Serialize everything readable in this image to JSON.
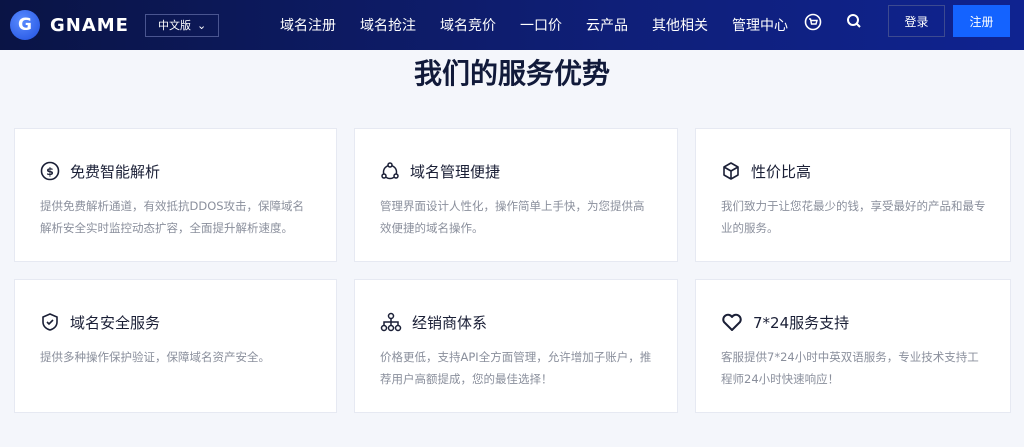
{
  "header": {
    "logo_letter": "G",
    "brand": "GNAME",
    "lang": "中文版",
    "nav": [
      "域名注册",
      "域名抢注",
      "域名竞价",
      "一口价",
      "云产品",
      "其他相关",
      "管理中心"
    ],
    "login": "登录",
    "register": "注册"
  },
  "title": "我们的服务优势",
  "cards": [
    {
      "icon": "dollar-icon",
      "title": "免费智能解析",
      "desc": "提供免费解析通道，有效抵抗DDOS攻击，保障域名解析安全实时监控动态扩容，全面提升解析速度。"
    },
    {
      "icon": "share-nodes-icon",
      "title": "域名管理便捷",
      "desc": "管理界面设计人性化，操作简单上手快，为您提供高效便捷的域名操作。"
    },
    {
      "icon": "box-icon",
      "title": "性价比高",
      "desc": "我们致力于让您花最少的钱，享受最好的产品和最专业的服务。"
    },
    {
      "icon": "shield-check-icon",
      "title": "域名安全服务",
      "desc": "提供多种操作保护验证，保障域名资产安全。"
    },
    {
      "icon": "hierarchy-icon",
      "title": "经销商体系",
      "desc": "价格更低，支持API全方面管理，允许增加子账户，推荐用户高额提成，您的最佳选择！"
    },
    {
      "icon": "heart-icon",
      "title": "7*24服务支持",
      "desc": "客服提供7*24小时中英双语服务，专业技术支持工程师24小时快速响应！"
    }
  ]
}
